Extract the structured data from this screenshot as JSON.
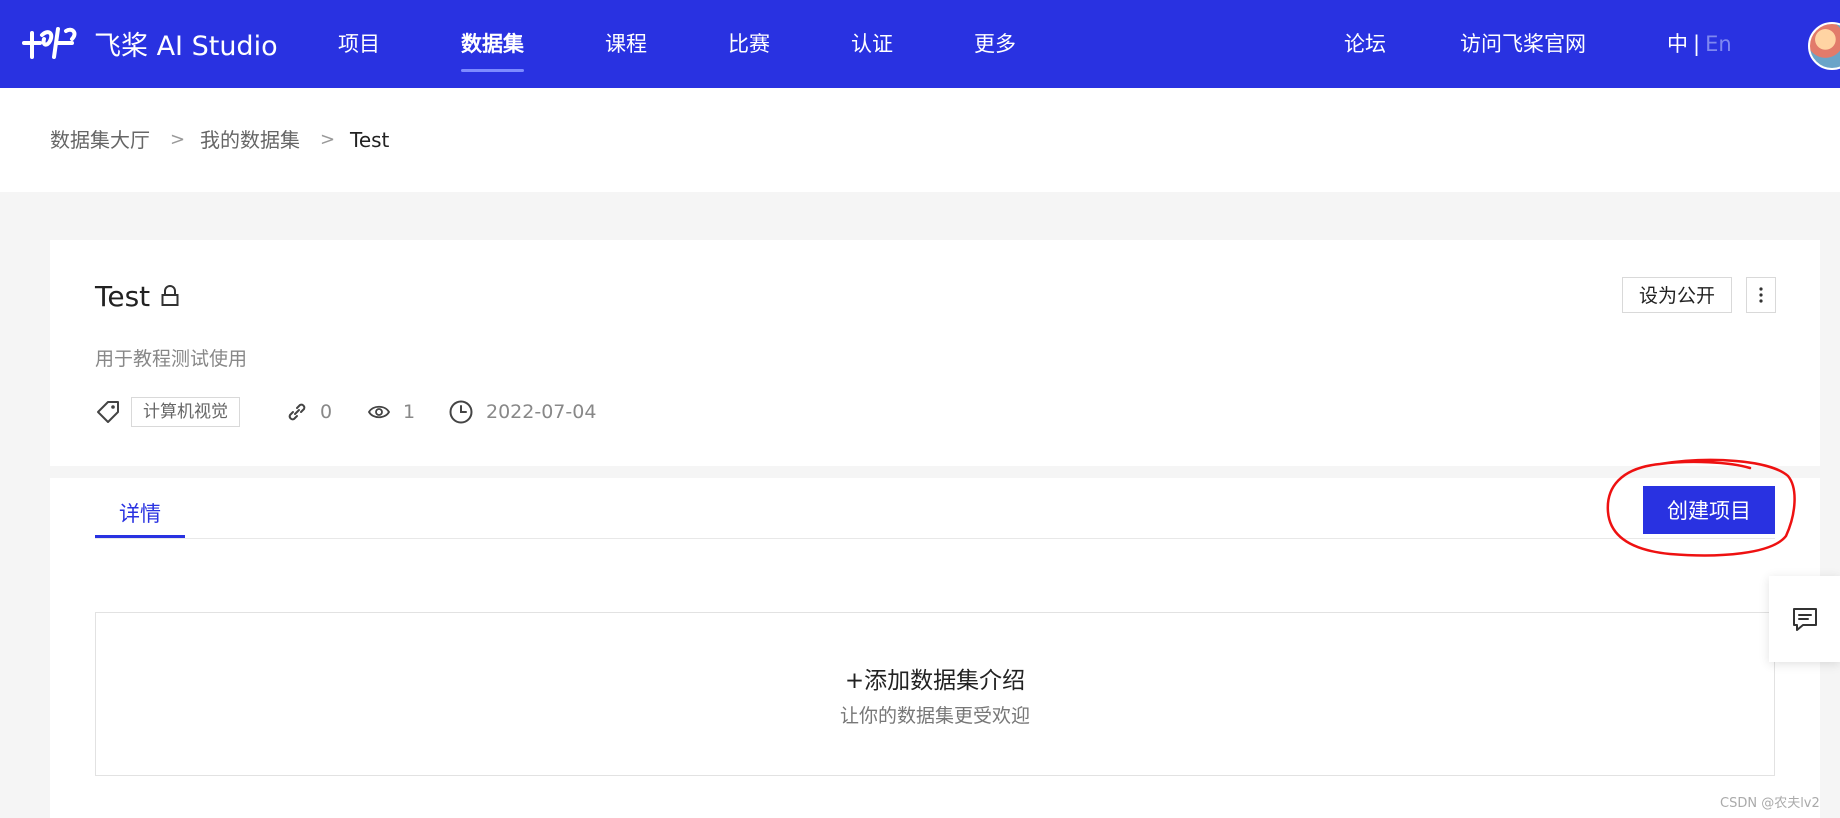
{
  "nav": {
    "logo_text": "飞桨 AI Studio",
    "items": [
      {
        "label": "项目"
      },
      {
        "label": "数据集"
      },
      {
        "label": "课程"
      },
      {
        "label": "比赛"
      },
      {
        "label": "认证"
      },
      {
        "label": "更多"
      }
    ],
    "active": "数据集",
    "forum": "论坛",
    "official": "访问飞桨官网",
    "lang_zh": "中",
    "lang_sep": "|",
    "lang_en": "En",
    "accent_color": "#2932e1"
  },
  "breadcrumb": [
    "数据集大厅",
    "我的数据集",
    "Test"
  ],
  "dataset": {
    "title": "Test",
    "description": "用于教程测试使用",
    "tag": "计算机视觉",
    "links": "0",
    "views": "1",
    "date": "2022-07-04",
    "set_public_label": "设为公开"
  },
  "tabs": [
    {
      "label": "详情"
    }
  ],
  "create_project_label": "创建项目",
  "intro": {
    "title": "+添加数据集介绍",
    "subtitle": "让你的数据集更受欢迎"
  },
  "watermark": "CSDN @农夫lv2"
}
